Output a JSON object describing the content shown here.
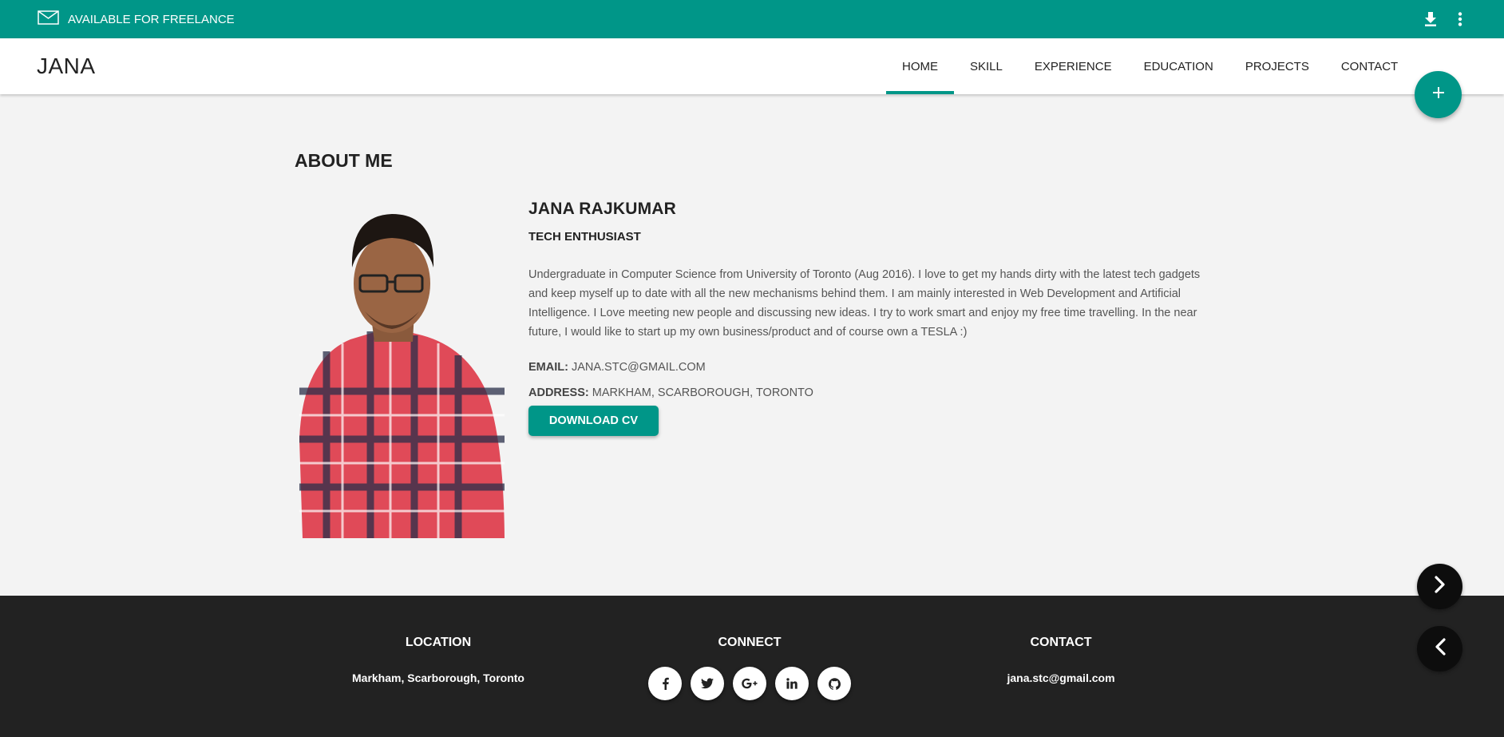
{
  "topbar": {
    "freelance_label": "AVAILABLE FOR FREELANCE",
    "icons": [
      "mail-icon",
      "download-icon",
      "more-vert-icon"
    ]
  },
  "brand": "JANA",
  "nav": {
    "items": [
      {
        "label": "HOME",
        "active": true
      },
      {
        "label": "SKILL",
        "active": false
      },
      {
        "label": "EXPERIENCE",
        "active": false
      },
      {
        "label": "EDUCATION",
        "active": false
      },
      {
        "label": "PROJECTS",
        "active": false
      },
      {
        "label": "CONTACT",
        "active": false
      }
    ]
  },
  "about": {
    "section_title": "ABOUT ME",
    "name": "JANA RAJKUMAR",
    "subtitle": "TECH ENTHUSIAST",
    "bio": "Undergraduate in Computer Science from University of Toronto (Aug 2016). I love to get my hands dirty with the latest tech gadgets and keep myself up to date with all the new mechanisms behind them. I am mainly interested in Web Development and Artificial Intelligence. I Love meeting new people and discussing new ideas. I try to work smart and enjoy my free time travelling. In the near future, I would like to start up my own business/product and of course own a TESLA :)",
    "email_label": "EMAIL:",
    "email_value": "JANA.STC@GMAIL.COM",
    "address_label": "ADDRESS:",
    "address_value": "MARKHAM, SCARBOROUGH, TORONTO",
    "cv_button": "DOWNLOAD CV"
  },
  "footer": {
    "location_title": "LOCATION",
    "location_value": "Markham, Scarborough, Toronto",
    "connect_title": "CONNECT",
    "socials": [
      "facebook-icon",
      "twitter-icon",
      "google-plus-icon",
      "linkedin-icon",
      "github-icon"
    ],
    "contact_title": "CONTACT",
    "contact_value": "jana.stc@gmail.com"
  },
  "colors": {
    "accent": "#009688",
    "footer_bg": "#222222",
    "page_bg": "#f3f3f3"
  }
}
